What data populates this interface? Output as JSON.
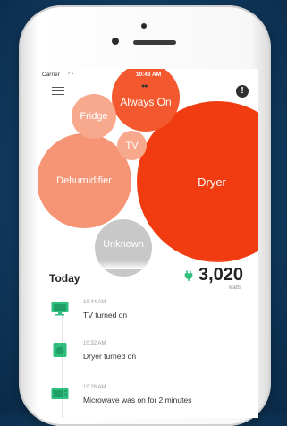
{
  "status_bar": {
    "carrier": "Carrier",
    "time": "10:43 AM"
  },
  "bubbles": [
    {
      "label": "Always On",
      "color": "#f4582e",
      "icon": "dots-icon"
    },
    {
      "label": "Fridge",
      "color": "#f8a98d"
    },
    {
      "label": "TV",
      "color": "#f8a98d"
    },
    {
      "label": "Dehumidifier",
      "color": "#f59576"
    },
    {
      "label": "Dryer",
      "color": "#f03c10"
    },
    {
      "label": "Unknown",
      "color": "#c8c8c8"
    }
  ],
  "summary": {
    "label": "Today",
    "value": "3,020",
    "unit": "watts",
    "accent": "#2fbf7f"
  },
  "events": [
    {
      "time": "10:44 AM",
      "text": "TV turned on",
      "icon": "tv-icon"
    },
    {
      "time": "10:32 AM",
      "text": "Dryer turned on",
      "icon": "dryer-icon"
    },
    {
      "time": "10:28 AM",
      "text": "Microwave was on for 2 minutes",
      "icon": "microwave-icon"
    }
  ]
}
